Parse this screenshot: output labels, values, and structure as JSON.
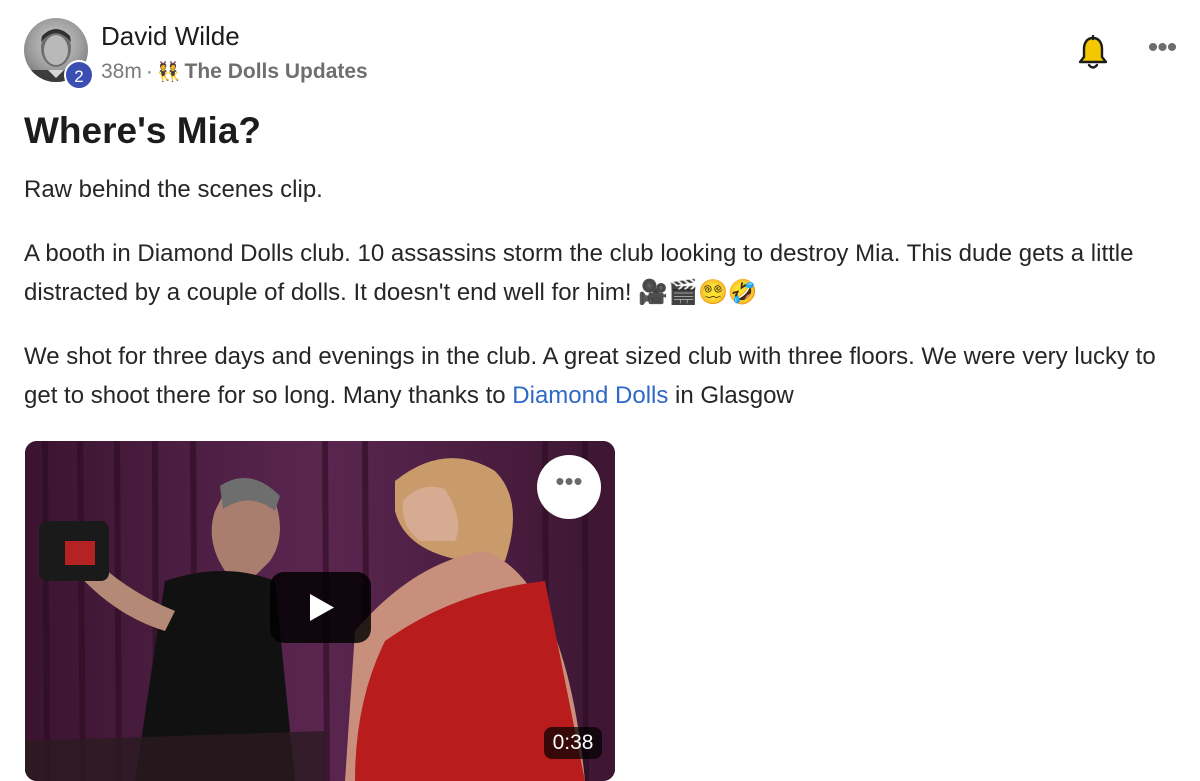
{
  "post": {
    "author": "David Wilde",
    "badge_count": "2",
    "time": "38m",
    "separator": "·",
    "space_emoji": "👯",
    "space_name": "The Dolls Updates",
    "title": "Where's Mia?",
    "paragraph1": "Raw behind the scenes clip.",
    "paragraph2_text": "A booth in Diamond Dolls club. 10 assassins storm the club looking to destroy Mia. This dude gets a little distracted by a couple of dolls. It doesn't end well for him! ",
    "paragraph2_emojis": "🎥🎬😵‍💫🤣",
    "paragraph3_before": "We shot for three days and evenings in the club. A great sized club with three floors. We were very lucky to get to shoot there for so long. Many thanks to ",
    "paragraph3_link": "Diamond Dolls",
    "paragraph3_after": " in Glasgow"
  },
  "icons": {
    "bell": "bell-icon",
    "more": "more-icon",
    "play": "play-icon"
  },
  "video": {
    "more_label": "•••",
    "duration": "0:38"
  },
  "header": {
    "more_label": "•••"
  },
  "colors": {
    "link": "#2e69c6",
    "badge": "#3b4fb3",
    "bell": "#e3b500",
    "curtain": "#4a1f3f"
  }
}
